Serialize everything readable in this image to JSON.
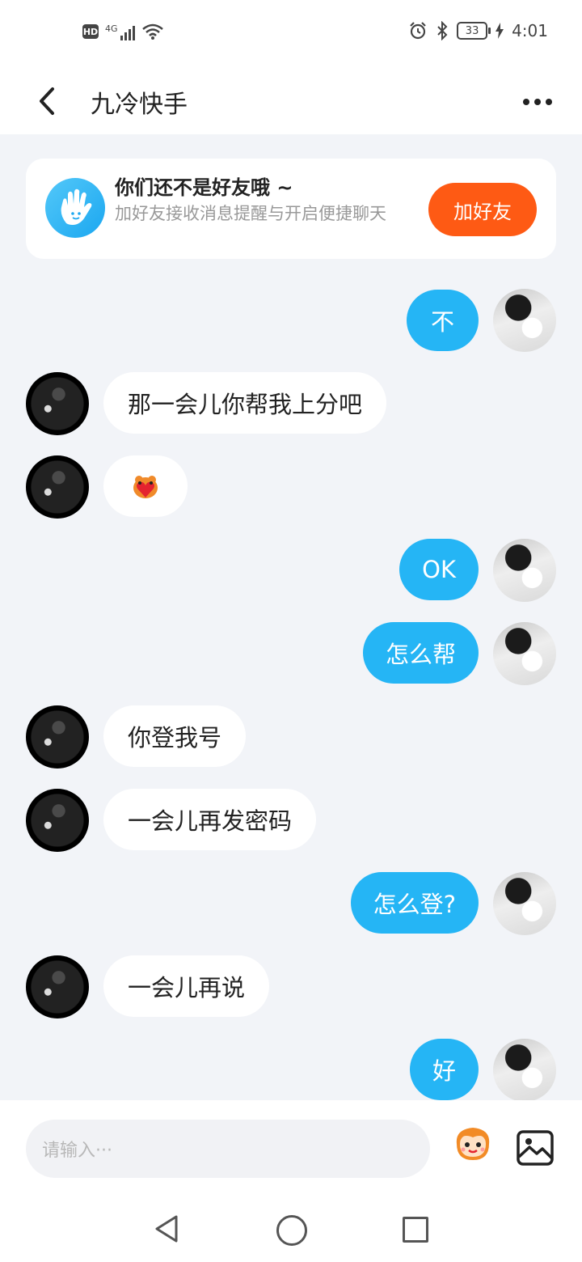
{
  "status_bar": {
    "hd": "HD",
    "network": "4G",
    "battery": "33",
    "time": "4:01"
  },
  "header": {
    "title": "九冷快手"
  },
  "friend_notice": {
    "title": "你们还不是好友哦 ~",
    "description": "加好友接收消息提醒与开启便捷聊天",
    "button": "加好友"
  },
  "messages": [
    {
      "side": "out",
      "text": "不"
    },
    {
      "side": "in",
      "text": "那一会儿你帮我上分吧"
    },
    {
      "side": "in",
      "text": "",
      "sticker": "red-heart-sticker"
    },
    {
      "side": "out",
      "text": "OK"
    },
    {
      "side": "out",
      "text": "怎么帮"
    },
    {
      "side": "in",
      "text": "你登我号"
    },
    {
      "side": "in",
      "text": "一会儿再发密码"
    },
    {
      "side": "out",
      "text": "怎么登?"
    },
    {
      "side": "in",
      "text": "一会儿再说"
    },
    {
      "side": "out",
      "text": "好"
    }
  ],
  "input": {
    "placeholder": "请输入···"
  },
  "colors": {
    "outgoing_bubble": "#25b5f5",
    "incoming_bubble": "#ffffff",
    "add_friend_button": "#fe5a14",
    "background": "#f2f4f8"
  }
}
